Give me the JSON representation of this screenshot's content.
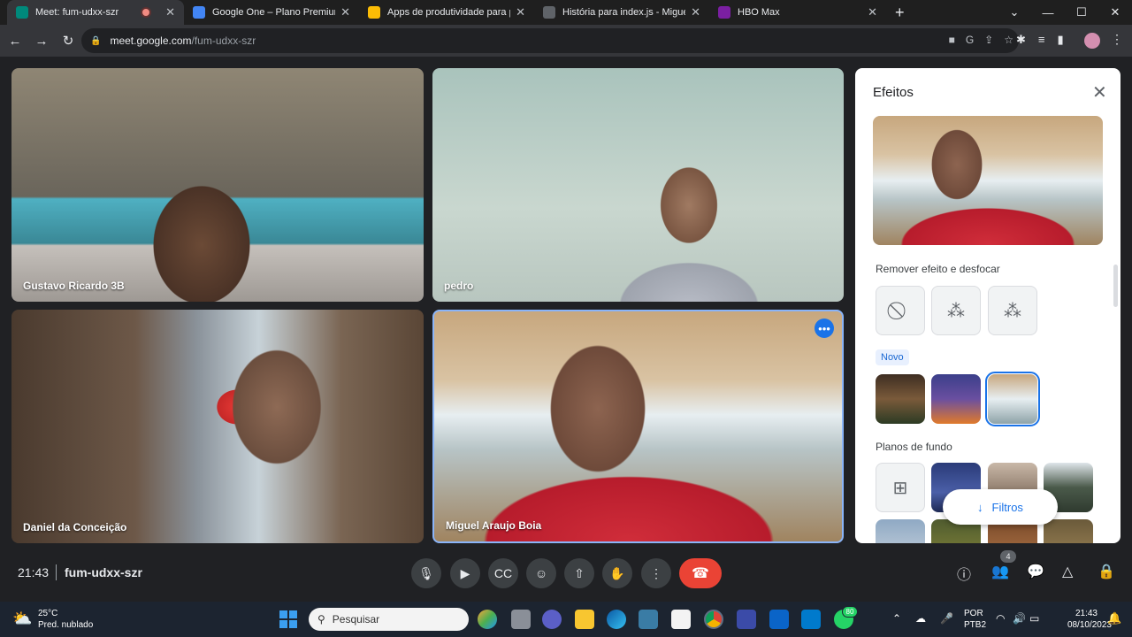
{
  "browser": {
    "tabs": [
      {
        "title": "Meet: fum-udxx-szr",
        "active": true,
        "favicon_color": "#00897b"
      },
      {
        "title": "Google One – Plano Premium",
        "active": false,
        "favicon_color": "#4285f4"
      },
      {
        "title": "Apps de produtividade para pro",
        "active": false,
        "favicon_color": "#fbbc05"
      },
      {
        "title": "História para index.js - MiguelBo",
        "active": false,
        "favicon_color": "#5f6368"
      },
      {
        "title": "HBO Max",
        "active": false,
        "favicon_color": "#7b1fa2"
      }
    ],
    "url_host": "meet.google.com",
    "url_path": "/fum-udxx-szr"
  },
  "participants": [
    {
      "name": "Gustavo Ricardo 3B"
    },
    {
      "name": "pedro"
    },
    {
      "name": "Daniel da Conceição"
    },
    {
      "name": "Miguel Araujo Boia"
    }
  ],
  "effects_panel": {
    "title": "Efeitos",
    "section_remove": "Remover efeito e desfocar",
    "new_label": "Novo",
    "section_backgrounds": "Planos de fundo",
    "filters_button": "Filtros"
  },
  "meeting": {
    "time": "21:43",
    "code": "fum-udxx-szr",
    "participant_count": "4"
  },
  "taskbar": {
    "temperature": "25°C",
    "weather": "Pred. nublado",
    "search_placeholder": "Pesquisar",
    "lang_line1": "POR",
    "lang_line2": "PTB2",
    "time": "21:43",
    "date": "08/10/2023",
    "whatsapp_badge": "80"
  },
  "colors": {
    "accent": "#1a73e8",
    "end_call": "#ea4335",
    "meet_bg": "#202124"
  }
}
